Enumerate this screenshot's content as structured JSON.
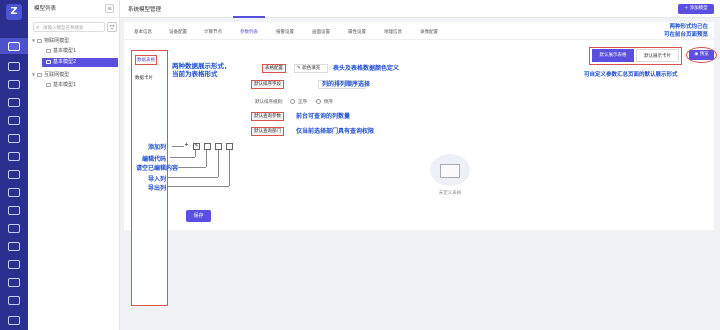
{
  "sidebar": {
    "header": "模型列表",
    "search_placeholder": "请输入模型名称搜索",
    "tree": [
      {
        "label": "物联网模型",
        "level": 0,
        "expanded": true
      },
      {
        "label": "基本模型1",
        "level": 1,
        "selected": false
      },
      {
        "label": "基本模型2",
        "level": 1,
        "selected": true
      },
      {
        "label": "互联网模型",
        "level": 0,
        "expanded": true
      },
      {
        "label": "基本模型1",
        "level": 1,
        "selected": false
      }
    ]
  },
  "header": {
    "title": "系统模型管理",
    "add_button": "+ 添加模型"
  },
  "tabs": [
    {
      "label": "基本信息"
    },
    {
      "label": "设备配置"
    },
    {
      "label": "计算节点"
    },
    {
      "label": "参数列表",
      "active": true
    },
    {
      "label": "报警设置"
    },
    {
      "label": "画面设置"
    },
    {
      "label": "属性设置"
    },
    {
      "label": "地理信息"
    },
    {
      "label": "录像配置"
    }
  ],
  "display_styles": {
    "table": "数据表格",
    "card": "数据卡片"
  },
  "form": {
    "table_config": "表格配置",
    "color_fill": "颜色填充",
    "default_sort_field": "默认排序字段",
    "default_sort_rule": "默认排序规则:",
    "asc": "正序",
    "desc": "倒序",
    "default_query_params": "默认查询参数",
    "default_query_dept": "默认查询部门",
    "save": "保存"
  },
  "empty_state": "未定义表格",
  "display_toggle": {
    "table": "默认展示表格",
    "card": "默认展示卡片",
    "preview": "预览"
  },
  "annotations": {
    "display_forms": "两种数据展示形式，\n当前为表格形式",
    "table_color": "表头及表格数据颜色定义",
    "sort_select": "列的排列顺序选择",
    "query_params": "前台可查询的列数量",
    "query_dept": "仅当前选择部门具有查询权限",
    "add_column": "添加列",
    "edit_code": "编辑代码",
    "clear_edit": "请空已编辑内容",
    "import_column": "导入列",
    "export_column": "导出列",
    "top_right": "两种形式均己在\n可在前台页面预览",
    "default_display": "可自定义参数汇总页面的默认展示形式"
  },
  "icons": {
    "logo": "logo-icon",
    "toolbar": [
      "plus-icon",
      "edit-icon",
      "trash-icon",
      "import-icon",
      "export-icon"
    ]
  },
  "colors": {
    "rail": "#2b2f8f",
    "accent": "#5b4fe0",
    "annotation": "#1f4fd1",
    "highlight": "#d9534f"
  }
}
